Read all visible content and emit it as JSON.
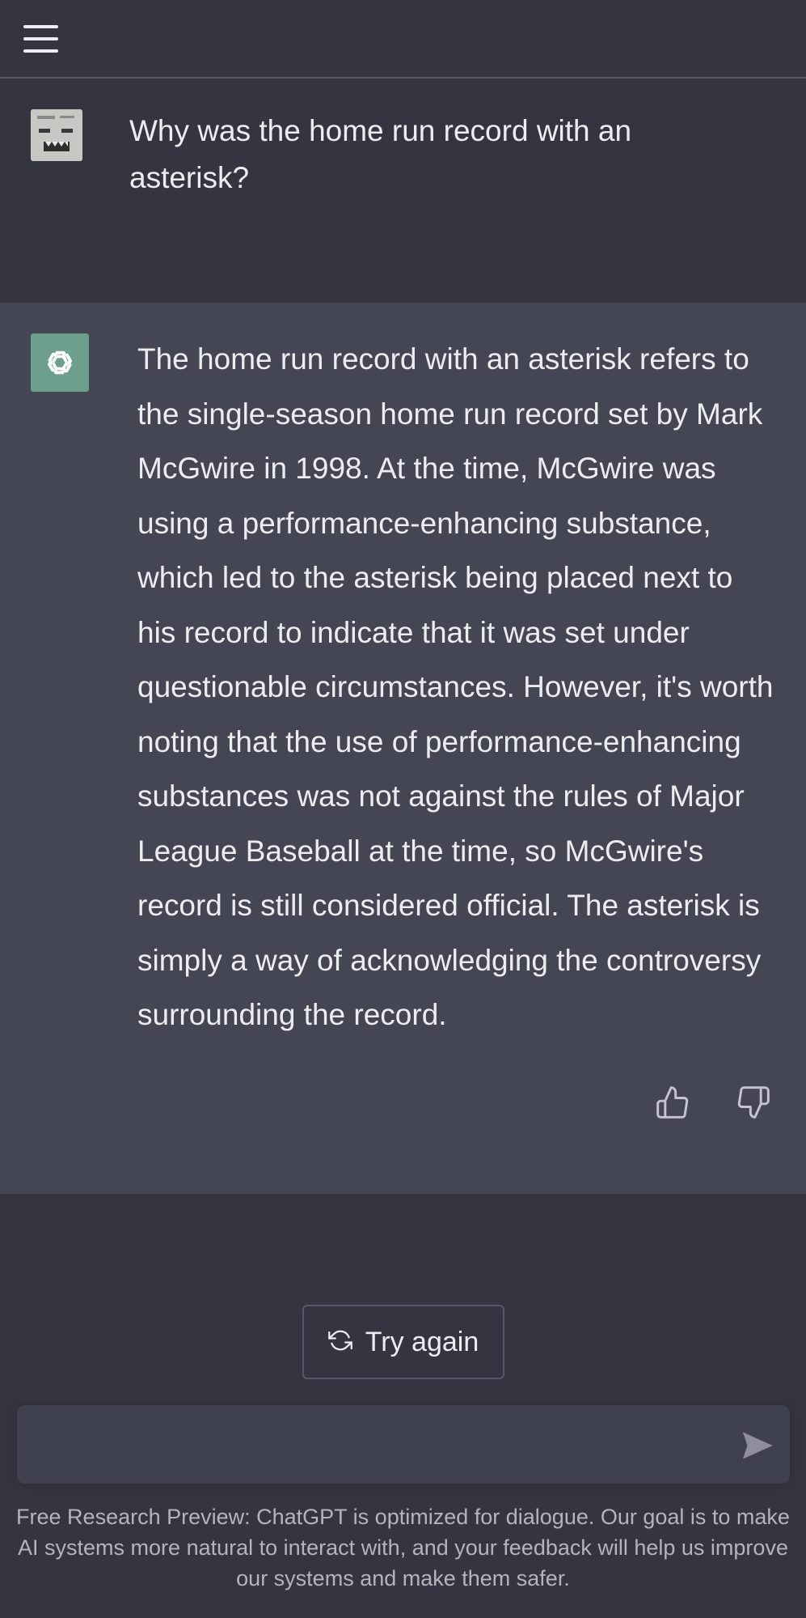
{
  "header": {
    "menu_icon": "hamburger-menu-icon"
  },
  "conversation": {
    "user_message": "Why was the home run record with an asterisk?",
    "assistant_message": "The home run record with an asterisk refers to the single-season home run record set by Mark McGwire in 1998. At the time, McGwire was using a performance-enhancing substance, which led to the asterisk being placed next to his record to indicate that it was set under questionable circumstances. However, it's worth noting that the use of performance-enhancing substances was not against the rules of Major League Baseball at the time, so McGwire's record is still considered official. The asterisk is simply a way of acknowledging the controversy surrounding the record.",
    "feedback_icons": [
      "thumbs-up-icon",
      "thumbs-down-icon"
    ]
  },
  "actions": {
    "try_again_label": "Try again"
  },
  "composer": {
    "value": "",
    "send_icon": "send-icon"
  },
  "footer": {
    "text": "Free Research Preview: ChatGPT is optimized for dialogue. Our goal is to make AI systems more natural to interact with, and your feedback will help us improve our systems and make them safer."
  },
  "colors": {
    "background": "#343541",
    "assistant_background": "#444654",
    "assistant_avatar": "#6e9f8e",
    "text": "#ececf1",
    "muted_text": "#b4b4bc"
  }
}
